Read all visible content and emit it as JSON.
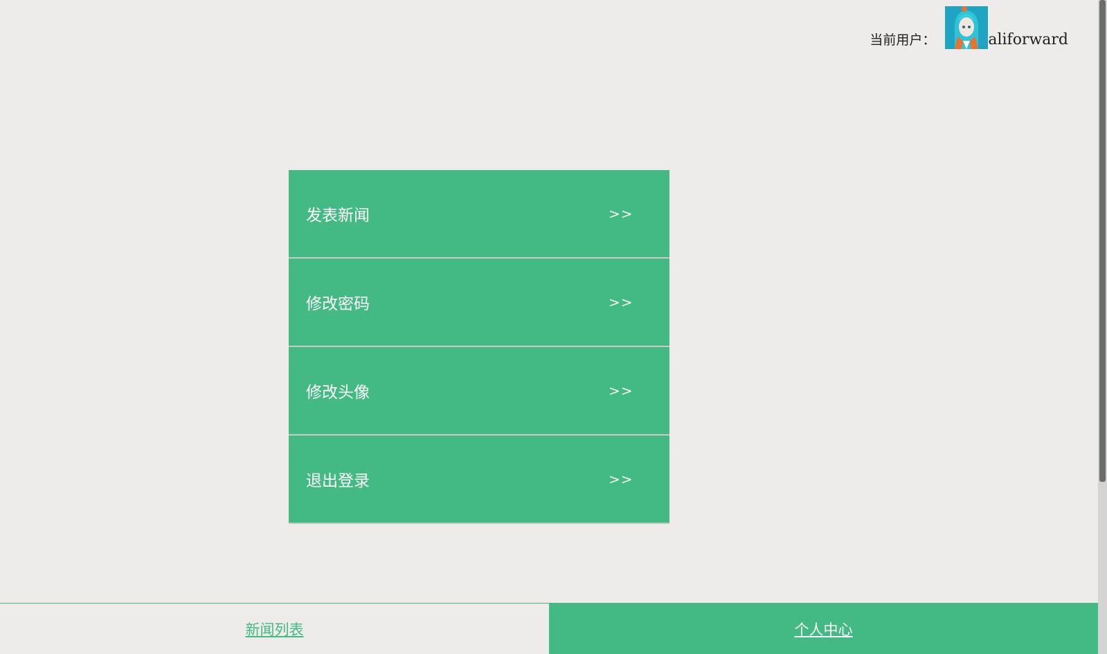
{
  "header": {
    "user_label": "当前用户：",
    "user_name": "aliforward"
  },
  "menu": {
    "items": [
      {
        "label": "发表新闻",
        "arrow": ">>"
      },
      {
        "label": "修改密码",
        "arrow": ">>"
      },
      {
        "label": "修改头像",
        "arrow": ">>"
      },
      {
        "label": "退出登录",
        "arrow": ">>"
      }
    ]
  },
  "bottom_nav": {
    "tabs": [
      {
        "label": "新闻列表",
        "active": false
      },
      {
        "label": "个人中心",
        "active": true
      }
    ]
  },
  "colors": {
    "accent": "#43b983",
    "background": "#edecea"
  }
}
